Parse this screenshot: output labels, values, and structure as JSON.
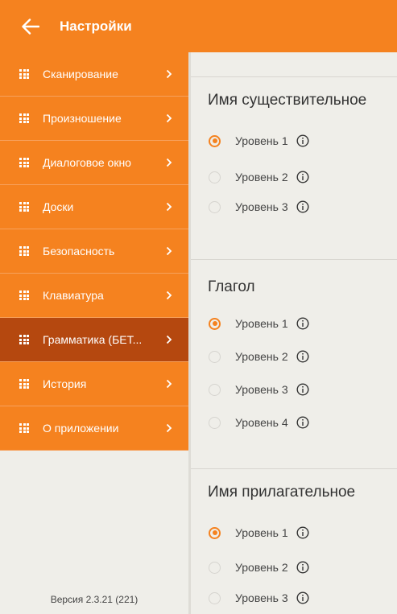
{
  "header": {
    "title": "Настройки",
    "back_icon": "arrow-left-icon"
  },
  "colors": {
    "accent": "#f5821f",
    "active": "#b5480f",
    "background": "#efeee9"
  },
  "sidebar": {
    "items": [
      {
        "label": "Сканирование",
        "active": false
      },
      {
        "label": "Произношение",
        "active": false
      },
      {
        "label": "Диалоговое окно",
        "active": false
      },
      {
        "label": "Доски",
        "active": false
      },
      {
        "label": "Безопасность",
        "active": false
      },
      {
        "label": "Клавиатура",
        "active": false
      },
      {
        "label": "Грамматика (БЕТ...",
        "active": true
      },
      {
        "label": "История",
        "active": false
      },
      {
        "label": "О приложении",
        "active": false
      }
    ],
    "version": "Версия 2.3.21 (221)"
  },
  "sections": [
    {
      "title": "Имя существительное",
      "options": [
        {
          "label": "Уровень 1",
          "selected": true
        },
        {
          "label": "Уровень 2",
          "selected": false
        },
        {
          "label": "Уровень 3",
          "selected": false
        }
      ]
    },
    {
      "title": "Глагол",
      "options": [
        {
          "label": "Уровень 1",
          "selected": true
        },
        {
          "label": "Уровень 2",
          "selected": false
        },
        {
          "label": "Уровень 3",
          "selected": false
        },
        {
          "label": "Уровень 4",
          "selected": false
        }
      ]
    },
    {
      "title": "Имя прилагательное",
      "options": [
        {
          "label": "Уровень 1",
          "selected": true
        },
        {
          "label": "Уровень 2",
          "selected": false
        },
        {
          "label": "Уровень 3",
          "selected": false
        }
      ]
    }
  ]
}
